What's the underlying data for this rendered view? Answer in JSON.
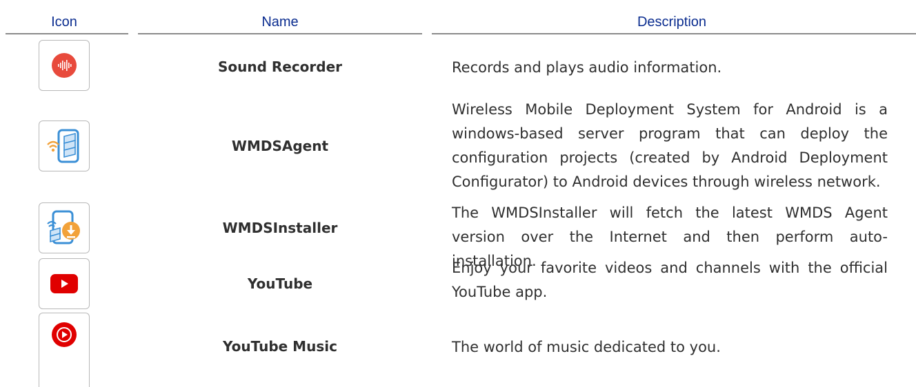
{
  "header": {
    "col_icon": "Icon",
    "col_name": "Name",
    "col_description": "Description"
  },
  "rows": [
    {
      "name": "Sound Recorder",
      "description": "Records and plays audio information.",
      "icon": "sound-recorder-icon"
    },
    {
      "name": "WMDSAgent",
      "description": "Wireless Mobile Deployment System for Android is a windows-based server program that can deploy the configuration projects (created by Android Deployment Configurator) to Android devices through wireless network.",
      "icon": "wmds-agent-icon"
    },
    {
      "name": "WMDSInstaller",
      "description": "The WMDSInstaller will fetch the latest WMDS Agent version over the Internet and then perform auto-installation.",
      "icon": "wmds-installer-icon"
    },
    {
      "name": "YouTube",
      "description": "Enjoy your favorite videos and channels with the official YouTube app.",
      "icon": "youtube-icon"
    },
    {
      "name": "YouTube Music",
      "description": "The world of music dedicated to you.",
      "icon": "youtube-music-icon"
    }
  ],
  "colors": {
    "header_text": "#0a2c8f",
    "rule": "#8a8a8a",
    "body_text": "#2f2f2f",
    "youtube_red": "#e00000",
    "recorder_red": "#e84a3c",
    "wmds_blue": "#3a8fd6",
    "wmds_orange": "#f2a23a"
  }
}
